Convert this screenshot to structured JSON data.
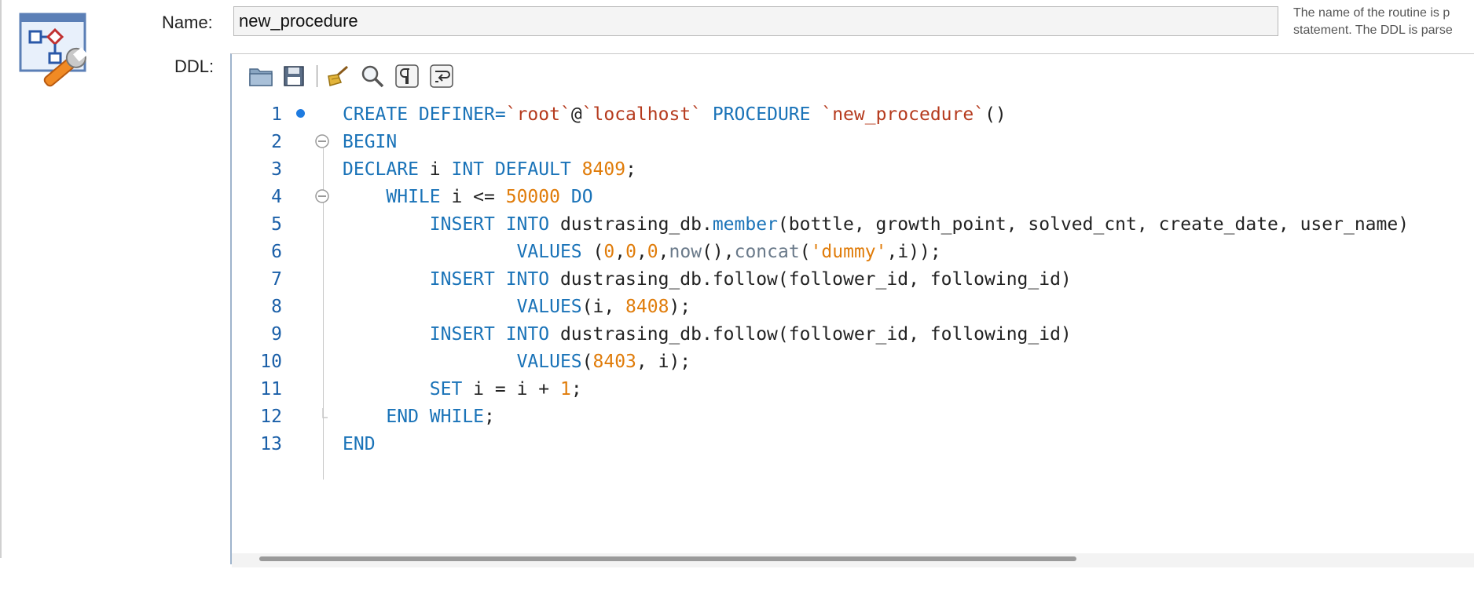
{
  "form": {
    "name_label": "Name:",
    "name_value": "new_procedure",
    "ddl_label": "DDL:",
    "help_line1": "The name of the routine is p",
    "help_line2": "statement. The DDL is parse"
  },
  "toolbar": {
    "buttons": [
      {
        "icon": "open-folder-icon"
      },
      {
        "icon": "save-icon"
      },
      {
        "icon": "beautify-broom-icon"
      },
      {
        "icon": "find-icon"
      },
      {
        "icon": "invisible-chars-icon"
      },
      {
        "icon": "word-wrap-icon"
      }
    ]
  },
  "colors": {
    "keyword": "#1a73b8",
    "string": "#b53a1d",
    "number": "#e07c0a",
    "function": "#6a7a8a",
    "line_number": "#1a5fa8"
  },
  "code": {
    "lines": [
      {
        "n": "1",
        "marker": true,
        "fold": null,
        "tokens": [
          [
            "kw",
            "CREATE DEFINER="
          ],
          [
            "str",
            "`root`"
          ],
          [
            "ident",
            "@"
          ],
          [
            "str",
            "`localhost`"
          ],
          [
            "ident",
            " "
          ],
          [
            "kw",
            "PROCEDURE"
          ],
          [
            "ident",
            " "
          ],
          [
            "str",
            "`new_procedure`"
          ],
          [
            "ident",
            "()"
          ]
        ]
      },
      {
        "n": "2",
        "marker": false,
        "fold": "start",
        "tokens": [
          [
            "kw",
            "BEGIN"
          ]
        ]
      },
      {
        "n": "3",
        "marker": false,
        "fold": null,
        "tokens": [
          [
            "kw",
            "DECLARE"
          ],
          [
            "ident",
            " i "
          ],
          [
            "kw",
            "INT DEFAULT"
          ],
          [
            "ident",
            " "
          ],
          [
            "num",
            "8409"
          ],
          [
            "ident",
            ";"
          ]
        ]
      },
      {
        "n": "4",
        "marker": false,
        "fold": "start",
        "tokens": [
          [
            "ident",
            "    "
          ],
          [
            "kw",
            "WHILE"
          ],
          [
            "ident",
            " i <= "
          ],
          [
            "num",
            "50000"
          ],
          [
            "ident",
            " "
          ],
          [
            "kw",
            "DO"
          ]
        ]
      },
      {
        "n": "5",
        "marker": false,
        "fold": null,
        "tokens": [
          [
            "ident",
            "        "
          ],
          [
            "kw",
            "INSERT INTO"
          ],
          [
            "ident",
            " dustrasing_db."
          ],
          [
            "kw",
            "member"
          ],
          [
            "ident",
            "(bottle, growth_point, solved_cnt, create_date, user_name)"
          ]
        ]
      },
      {
        "n": "6",
        "marker": false,
        "fold": null,
        "tokens": [
          [
            "ident",
            "                "
          ],
          [
            "kw",
            "VALUES"
          ],
          [
            "ident",
            " ("
          ],
          [
            "num",
            "0"
          ],
          [
            "ident",
            ","
          ],
          [
            "num",
            "0"
          ],
          [
            "ident",
            ","
          ],
          [
            "num",
            "0"
          ],
          [
            "ident",
            ","
          ],
          [
            "fn",
            "now"
          ],
          [
            "ident",
            "(),"
          ],
          [
            "fn",
            "concat"
          ],
          [
            "ident",
            "("
          ],
          [
            "num",
            "'dummy'"
          ],
          [
            "ident",
            ",i));"
          ]
        ]
      },
      {
        "n": "7",
        "marker": false,
        "fold": null,
        "tokens": [
          [
            "ident",
            "        "
          ],
          [
            "kw",
            "INSERT INTO"
          ],
          [
            "ident",
            " dustrasing_db.follow(follower_id, following_id)"
          ]
        ]
      },
      {
        "n": "8",
        "marker": false,
        "fold": null,
        "tokens": [
          [
            "ident",
            "                "
          ],
          [
            "kw",
            "VALUES"
          ],
          [
            "ident",
            "(i, "
          ],
          [
            "num",
            "8408"
          ],
          [
            "ident",
            ");"
          ]
        ]
      },
      {
        "n": "9",
        "marker": false,
        "fold": null,
        "tokens": [
          [
            "ident",
            "        "
          ],
          [
            "kw",
            "INSERT INTO"
          ],
          [
            "ident",
            " dustrasing_db.follow(follower_id, following_id)"
          ]
        ]
      },
      {
        "n": "10",
        "marker": false,
        "fold": null,
        "tokens": [
          [
            "ident",
            "                "
          ],
          [
            "kw",
            "VALUES"
          ],
          [
            "ident",
            "("
          ],
          [
            "num",
            "8403"
          ],
          [
            "ident",
            ", i);"
          ]
        ]
      },
      {
        "n": "11",
        "marker": false,
        "fold": null,
        "tokens": [
          [
            "ident",
            "        "
          ],
          [
            "kw",
            "SET"
          ],
          [
            "ident",
            " i = i + "
          ],
          [
            "num",
            "1"
          ],
          [
            "ident",
            ";"
          ]
        ]
      },
      {
        "n": "12",
        "marker": false,
        "fold": "end",
        "tokens": [
          [
            "ident",
            "    "
          ],
          [
            "kw",
            "END WHILE"
          ],
          [
            "ident",
            ";"
          ]
        ]
      },
      {
        "n": "13",
        "marker": false,
        "fold": null,
        "tokens": [
          [
            "kw",
            "END"
          ]
        ]
      }
    ]
  }
}
